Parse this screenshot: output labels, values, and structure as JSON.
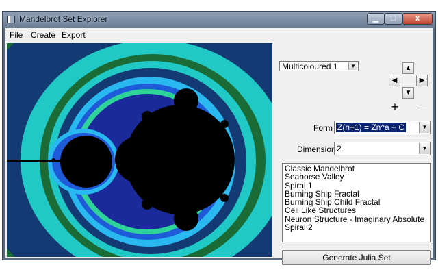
{
  "window": {
    "title": "Mandelbrot Set Explorer",
    "close_glyph": "x"
  },
  "menu": [
    "File",
    "Create",
    "Export"
  ],
  "controls": {
    "color_scheme": "Multicoloured 1",
    "form_label": "Form",
    "form_value": "Z(n+1) = Zn^a + C",
    "dimension_label": "Dimension",
    "dimension_value": "2",
    "zoom_in_glyph": "+",
    "zoom_out_glyph": "—"
  },
  "presets": [
    "Classic Mandelbrot",
    "Seahorse Valley",
    "Spiral 1",
    "Burning Ship Fractal",
    "Burning Ship Child Fractal",
    "Cell Like Structures",
    "Neuron Structure - Imaginary Absolute",
    "Spiral 2"
  ],
  "generate_label": "Generate Julia Set",
  "icons": [
    "app-icon",
    "minimize-icon",
    "maximize-icon",
    "close-icon",
    "pan-up-icon",
    "pan-left-icon",
    "pan-right-icon",
    "pan-down-icon",
    "zoom-in-icon",
    "zoom-out-icon",
    "dropdown-arrow-icon"
  ],
  "colors": {
    "form_highlight": "#0a2470",
    "fractal_interior": "#000000",
    "fractal_palette": [
      "#143a73",
      "#21c9c6",
      "#1a6b36",
      "#29b8f0",
      "#1f5bd8",
      "#2ed39a"
    ]
  }
}
